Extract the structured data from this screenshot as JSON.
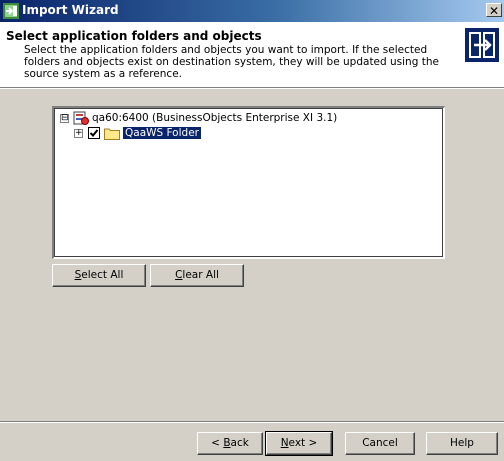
{
  "window": {
    "title": "Import Wizard",
    "close_glyph": "✕"
  },
  "header": {
    "heading": "Select application folders and objects",
    "description": "Select the application folders and objects you want to import. If the selected folders and objects exist on destination system, they will be updated using the source system as a reference."
  },
  "tree": {
    "root": {
      "expander": "⊟",
      "label": "qa60:6400 (BusinessObjects Enterprise XI 3.1)",
      "icon": "server-icon"
    },
    "children": [
      {
        "expander": "+",
        "checked": true,
        "label": "QaaWS Folder",
        "icon": "folder-icon",
        "selected": true
      }
    ]
  },
  "selection_buttons": {
    "select_all": {
      "mnemonic": "S",
      "rest": "elect All"
    },
    "clear_all": {
      "mnemonic": "C",
      "rest": "lear All"
    }
  },
  "footer_buttons": {
    "back": {
      "prefix": "< ",
      "mnemonic": "B",
      "rest": "ack"
    },
    "next": {
      "mnemonic": "N",
      "rest": "ext >"
    },
    "cancel": "Cancel",
    "help": "Help"
  },
  "colors": {
    "titlebar_start": "#0a246a",
    "titlebar_end": "#a6caf0",
    "dialog_face": "#d4d0c8",
    "selection": "#0a246a"
  }
}
